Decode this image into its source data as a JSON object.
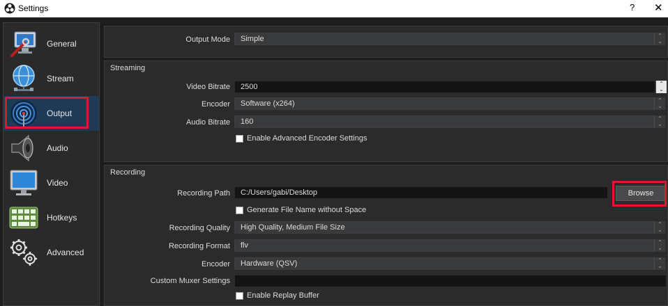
{
  "window": {
    "title": "Settings",
    "help_glyph": "?",
    "close_glyph": "✕"
  },
  "sidebar": {
    "items": [
      {
        "label": "General",
        "icon": "monitor-wrench-icon"
      },
      {
        "label": "Stream",
        "icon": "globe-network-icon"
      },
      {
        "label": "Output",
        "icon": "antenna-signal-icon",
        "active": true
      },
      {
        "label": "Audio",
        "icon": "speaker-icon"
      },
      {
        "label": "Video",
        "icon": "monitor-icon"
      },
      {
        "label": "Hotkeys",
        "icon": "keyboard-icon"
      },
      {
        "label": "Advanced",
        "icon": "gears-icon"
      }
    ]
  },
  "output_mode": {
    "label": "Output Mode",
    "value": "Simple"
  },
  "streaming": {
    "title": "Streaming",
    "video_bitrate": {
      "label": "Video Bitrate",
      "value": "2500"
    },
    "encoder": {
      "label": "Encoder",
      "value": "Software (x264)"
    },
    "audio_bitrate": {
      "label": "Audio Bitrate",
      "value": "160"
    },
    "advanced_encoder": {
      "label": "Enable Advanced Encoder Settings",
      "checked": false
    }
  },
  "recording": {
    "title": "Recording",
    "path": {
      "label": "Recording Path",
      "value": "C:/Users/gabi/Desktop"
    },
    "browse_label": "Browse",
    "no_space": {
      "label": "Generate File Name without Space",
      "checked": false
    },
    "quality": {
      "label": "Recording Quality",
      "value": "High Quality, Medium File Size"
    },
    "format": {
      "label": "Recording Format",
      "value": "flv"
    },
    "encoder": {
      "label": "Encoder",
      "value": "Hardware (QSV)"
    },
    "muxer": {
      "label": "Custom Muxer Settings",
      "value": ""
    },
    "replay_buffer": {
      "label": "Enable Replay Buffer",
      "checked": false
    }
  },
  "colors": {
    "highlight": "#e0182d",
    "active_nav": "#1e3a54",
    "background": "#1f1e1f"
  }
}
